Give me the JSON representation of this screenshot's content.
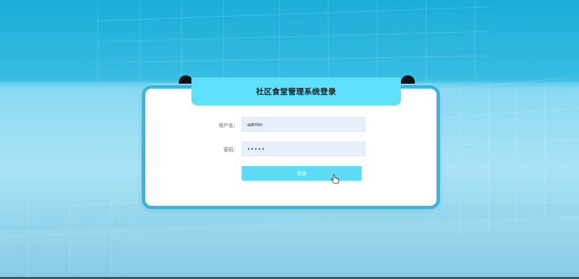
{
  "page": {
    "title": "社区食堂管理系统登录"
  },
  "form": {
    "username_label": "用户名：",
    "username_value": "admin",
    "password_label": "密码：",
    "password_value": "•••••",
    "login_label": "登录"
  },
  "icons": {
    "cursor": "hand-pointer-icon"
  },
  "colors": {
    "accent": "#5fe0fa",
    "card_border": "#3ab5e0",
    "input_bg": "#e8effc"
  }
}
